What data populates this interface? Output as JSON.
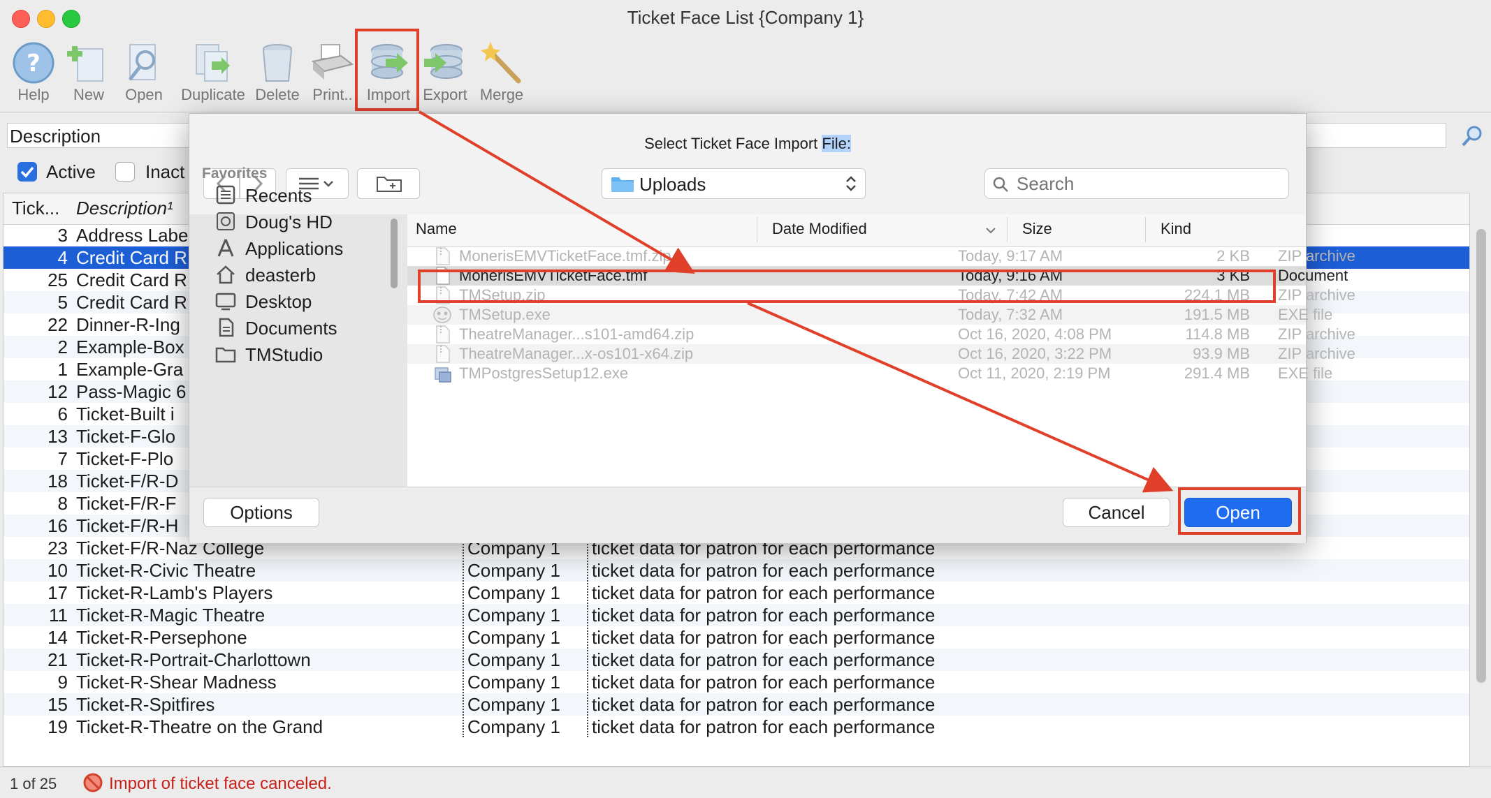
{
  "window": {
    "title": "Ticket Face List {Company 1}"
  },
  "toolbar": {
    "items": [
      {
        "label": "Help",
        "icon": "help-icon"
      },
      {
        "label": "New",
        "icon": "new-icon"
      },
      {
        "label": "Open",
        "icon": "open-icon"
      },
      {
        "label": "Duplicate",
        "icon": "duplicate-icon"
      },
      {
        "label": "Delete",
        "icon": "delete-icon"
      },
      {
        "label": "Print..",
        "icon": "print-icon"
      },
      {
        "label": "Import",
        "icon": "import-icon"
      },
      {
        "label": "Export",
        "icon": "export-icon"
      },
      {
        "label": "Merge",
        "icon": "merge-icon"
      }
    ]
  },
  "search": {
    "field_label": "Description"
  },
  "filters": {
    "active_label": "Active",
    "active_checked": true,
    "inactive_label": "Inact",
    "inactive_checked": false
  },
  "table": {
    "columns": [
      "Tick...",
      "Description¹"
    ],
    "rows": [
      {
        "num": "3",
        "desc": "Address Labe",
        "company": "",
        "text": ""
      },
      {
        "num": "4",
        "desc": "Credit Card R",
        "company": "",
        "text": "",
        "selected": true
      },
      {
        "num": "25",
        "desc": "Credit Card R",
        "company": "",
        "text": ""
      },
      {
        "num": "5",
        "desc": "Credit Card R",
        "company": "",
        "text": ""
      },
      {
        "num": "22",
        "desc": "Dinner-R-Ing",
        "company": "",
        "text": ""
      },
      {
        "num": "2",
        "desc": "Example-Box",
        "company": "",
        "text": ""
      },
      {
        "num": "1",
        "desc": "Example-Gra",
        "company": "",
        "text": ""
      },
      {
        "num": "12",
        "desc": "Pass-Magic 6",
        "company": "",
        "text": ""
      },
      {
        "num": "6",
        "desc": "Ticket-Built i",
        "company": "",
        "text": ""
      },
      {
        "num": "13",
        "desc": "Ticket-F-Glo",
        "company": "",
        "text": ""
      },
      {
        "num": "7",
        "desc": "Ticket-F-Plo",
        "company": "",
        "text": ""
      },
      {
        "num": "18",
        "desc": "Ticket-F/R-D",
        "company": "",
        "text": ""
      },
      {
        "num": "8",
        "desc": "Ticket-F/R-F",
        "company": "",
        "text": ""
      },
      {
        "num": "16",
        "desc": "Ticket-F/R-H",
        "company": "",
        "text": ""
      },
      {
        "num": "23",
        "desc": "Ticket-F/R-Naz College",
        "company": "Company 1",
        "text": "ticket data for patron for each performance"
      },
      {
        "num": "10",
        "desc": "Ticket-R-Civic Theatre",
        "company": "Company 1",
        "text": "ticket data for patron for each performance"
      },
      {
        "num": "17",
        "desc": "Ticket-R-Lamb's Players",
        "company": "Company 1",
        "text": "ticket data for patron for each performance"
      },
      {
        "num": "11",
        "desc": "Ticket-R-Magic Theatre",
        "company": "Company 1",
        "text": "ticket data for patron for each performance"
      },
      {
        "num": "14",
        "desc": "Ticket-R-Persephone",
        "company": "Company 1",
        "text": "ticket data for patron for each performance"
      },
      {
        "num": "21",
        "desc": "Ticket-R-Portrait-Charlottown",
        "company": "Company 1",
        "text": "ticket data for patron for each performance"
      },
      {
        "num": "9",
        "desc": "Ticket-R-Shear Madness",
        "company": "Company 1",
        "text": "ticket data for patron for each performance"
      },
      {
        "num": "15",
        "desc": "Ticket-R-Spitfires",
        "company": "Company 1",
        "text": "ticket data for patron for each performance"
      },
      {
        "num": "19",
        "desc": "Ticket-R-Theatre on the Grand",
        "company": "Company 1",
        "text": "ticket data for patron for each performance"
      }
    ]
  },
  "status": {
    "count": "1 of 25",
    "message": "Import of ticket face canceled."
  },
  "dialog": {
    "title_prefix": "Select Ticket Face Import ",
    "title_highlight": "File:",
    "location": "Uploads",
    "search_placeholder": "Search",
    "sidebar": {
      "heading": "Favorites",
      "items": [
        {
          "label": "Recents",
          "icon": "recents-icon"
        },
        {
          "label": "Doug's HD",
          "icon": "hard-drive-icon"
        },
        {
          "label": "Applications",
          "icon": "applications-icon"
        },
        {
          "label": "deasterb",
          "icon": "home-icon"
        },
        {
          "label": "Desktop",
          "icon": "desktop-icon"
        },
        {
          "label": "Documents",
          "icon": "documents-icon"
        },
        {
          "label": "TMStudio",
          "icon": "folder-icon"
        }
      ]
    },
    "columns": {
      "name": "Name",
      "date": "Date Modified",
      "size": "Size",
      "kind": "Kind"
    },
    "files": [
      {
        "name": "MonerisEMVTicketFace.tmf.zip",
        "date": "Today, 9:17 AM",
        "size": "2 KB",
        "kind": "ZIP archive",
        "icon": "zip-file-icon",
        "state": "dim"
      },
      {
        "name": "MonerisEMVTicketFace.tmf",
        "date": "Today, 9:16 AM",
        "size": "3 KB",
        "kind": "Document",
        "icon": "document-icon",
        "state": "on"
      },
      {
        "name": "TMSetup.zip",
        "date": "Today, 7:42 AM",
        "size": "224.1 MB",
        "kind": "ZIP archive",
        "icon": "zip-file-icon",
        "state": "dim"
      },
      {
        "name": "TMSetup.exe",
        "date": "Today, 7:32 AM",
        "size": "191.5 MB",
        "kind": "EXE file",
        "icon": "exe-mask-icon",
        "state": "dim"
      },
      {
        "name": "TheatreManager...s101-amd64.zip",
        "date": "Oct 16, 2020, 4:08 PM",
        "size": "114.8 MB",
        "kind": "ZIP archive",
        "icon": "zip-file-icon",
        "state": "dim"
      },
      {
        "name": "TheatreManager...x-os101-x64.zip",
        "date": "Oct 16, 2020, 3:22 PM",
        "size": "93.9 MB",
        "kind": "ZIP archive",
        "icon": "zip-file-icon",
        "state": "dim"
      },
      {
        "name": "TMPostgresSetup12.exe",
        "date": "Oct 11, 2020, 2:19 PM",
        "size": "291.4 MB",
        "kind": "EXE file",
        "icon": "exe-installer-icon",
        "state": "dim"
      }
    ],
    "buttons": {
      "options": "Options",
      "cancel": "Cancel",
      "open": "Open"
    }
  }
}
